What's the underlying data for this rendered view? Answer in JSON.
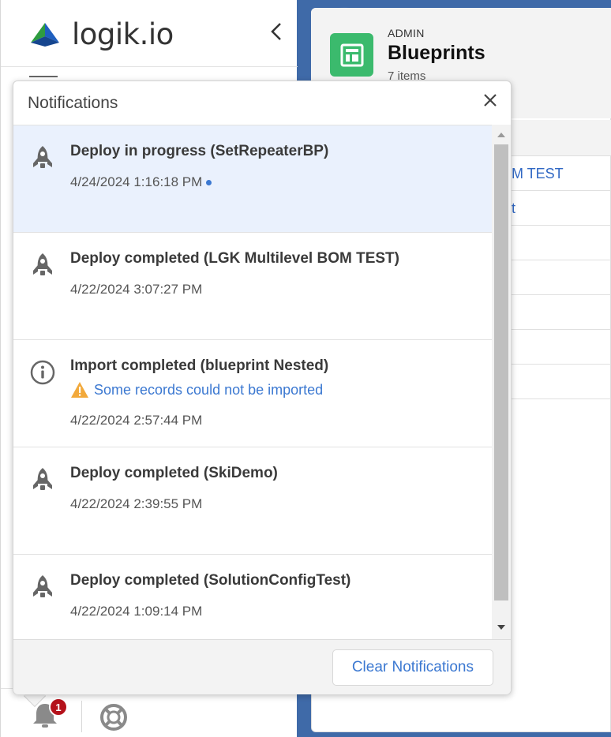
{
  "sidebar": {
    "logo_text": "logik.io",
    "bell_badge": "1"
  },
  "record": {
    "kicker": "ADMIN",
    "title": "Blueprints",
    "count": "7 items",
    "rows": [
      "M TEST",
      "t",
      "",
      "",
      "",
      "",
      ""
    ]
  },
  "notifications": {
    "title": "Notifications",
    "items": [
      {
        "icon": "rocket-icon",
        "title": "Deploy in progress (SetRepeaterBP)",
        "time": "4/24/2024 1:16:18 PM",
        "unread": true
      },
      {
        "icon": "rocket-icon",
        "title": "Deploy completed (LGK Multilevel BOM TEST)",
        "time": "4/22/2024 3:07:27 PM"
      },
      {
        "icon": "info-icon",
        "title": "Import completed (blueprint Nested)",
        "subtitle": "Some records could not be imported",
        "time": "4/22/2024 2:57:44 PM"
      },
      {
        "icon": "rocket-icon",
        "title": "Deploy completed (SkiDemo)",
        "time": "4/22/2024 2:39:55 PM"
      },
      {
        "icon": "rocket-icon",
        "title": "Deploy completed (SolutionConfigTest)",
        "time": "4/22/2024 1:09:14 PM"
      }
    ],
    "clear_label": "Clear Notifications"
  },
  "colors": {
    "accent": "#3b78d1",
    "badge": "#b5121b",
    "unread_bg": "#eaf1fd",
    "object_icon": "#3bba6d"
  }
}
